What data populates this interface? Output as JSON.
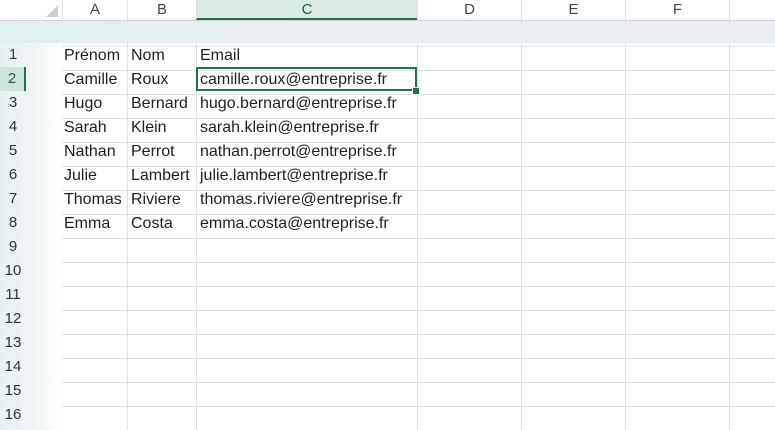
{
  "spreadsheet": {
    "columns": [
      "A",
      "B",
      "C",
      "D",
      "E",
      "F"
    ],
    "active_column": "C",
    "rows": [
      "1",
      "2",
      "3",
      "4",
      "5",
      "6",
      "7",
      "8",
      "9",
      "10",
      "11",
      "12",
      "13",
      "14",
      "15",
      "16"
    ],
    "active_row": "2",
    "active_cell": "C2",
    "header": [
      "Prénom",
      "Nom",
      "Email"
    ],
    "records": [
      [
        "Camille",
        "Roux",
        "camille.roux@entreprise.fr"
      ],
      [
        "Hugo",
        "Bernard",
        "hugo.bernard@entreprise.fr"
      ],
      [
        "Sarah",
        "Klein",
        "sarah.klein@entreprise.fr"
      ],
      [
        "Nathan",
        "Perrot",
        "nathan.perrot@entreprise.fr"
      ],
      [
        "Julie",
        "Lambert",
        "julie.lambert@entreprise.fr"
      ],
      [
        "Thomas",
        "Riviere",
        "thomas.riviere@entreprise.fr"
      ],
      [
        "Emma",
        "Costa",
        "emma.costa@entreprise.fr"
      ]
    ]
  }
}
